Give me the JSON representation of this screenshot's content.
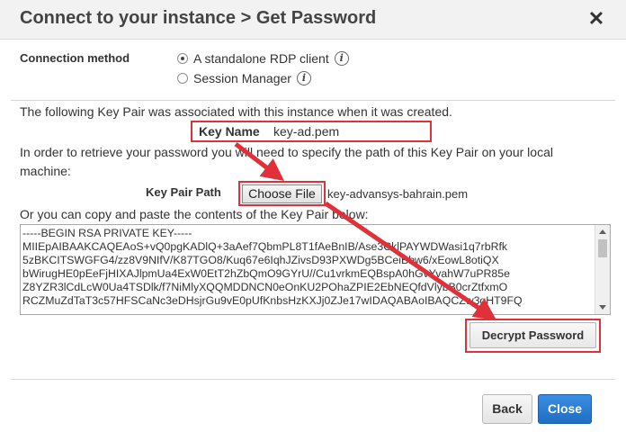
{
  "dialog": {
    "title": "Connect to your instance > Get Password",
    "close_glyph": "✕"
  },
  "connection": {
    "label": "Connection method",
    "options": [
      {
        "label": "A standalone RDP client",
        "selected": true
      },
      {
        "label": "Session Manager",
        "selected": false
      }
    ],
    "info_glyph": "i"
  },
  "key_pair": {
    "associated_text": "The following Key Pair was associated with this instance when it was created.",
    "key_name_label": "Key Name",
    "key_name_value": "key-ad.pem",
    "retrieve_text_1": "In order to retrieve your password you will need to specify the path of this Key Pair on your local",
    "retrieve_text_2": "machine:",
    "path_label": "Key Pair Path",
    "choose_file_label": "Choose File",
    "chosen_file": "key-advansys-bahrain.pem",
    "paste_text": "Or you can copy and paste the contents of the Key Pair below:",
    "contents_lines": [
      "-----BEGIN RSA PRIVATE KEY-----",
      "MIIEpAIBAAKCAQEAoS+vQ0pgKADlQ+3aAef7QbmPL8T1fAeBnIB/Ase3CklPAYWDWasi1q7rbRfk",
      "5zBKCITSWGFG4/zz8V9NIfV/K87TGO8/Kuq67e6IqhJZivsD93PXWDg5BCeiBbw6/xEowL8otiQX",
      "bWirugHE0pEeFjHIXAJlpmUa4ExW0EtT2hZbQmO9GYrU//Cu1vrkmEQBspA0hGvYvahW7uPR85e",
      "Z8YZR3lCdLcW0Ua4TSDlk/f7NiMlyXQQMDDNCN0eOnKU2POhaZPIE2EbNEQfdVlybB0crZtfxmO",
      "RCZMuZdTaT3c57HFSCaNc3eDHsjrGu9vE0pUfKnbsHzKXJj0ZJe17wIDAQABAoIBAQCZw3qHT9FQ"
    ]
  },
  "actions": {
    "decrypt_label": "Decrypt Password",
    "back_label": "Back",
    "close_label": "Close"
  },
  "colors": {
    "highlight_red": "#e0313a",
    "primary_blue": "#1f6fc5"
  }
}
